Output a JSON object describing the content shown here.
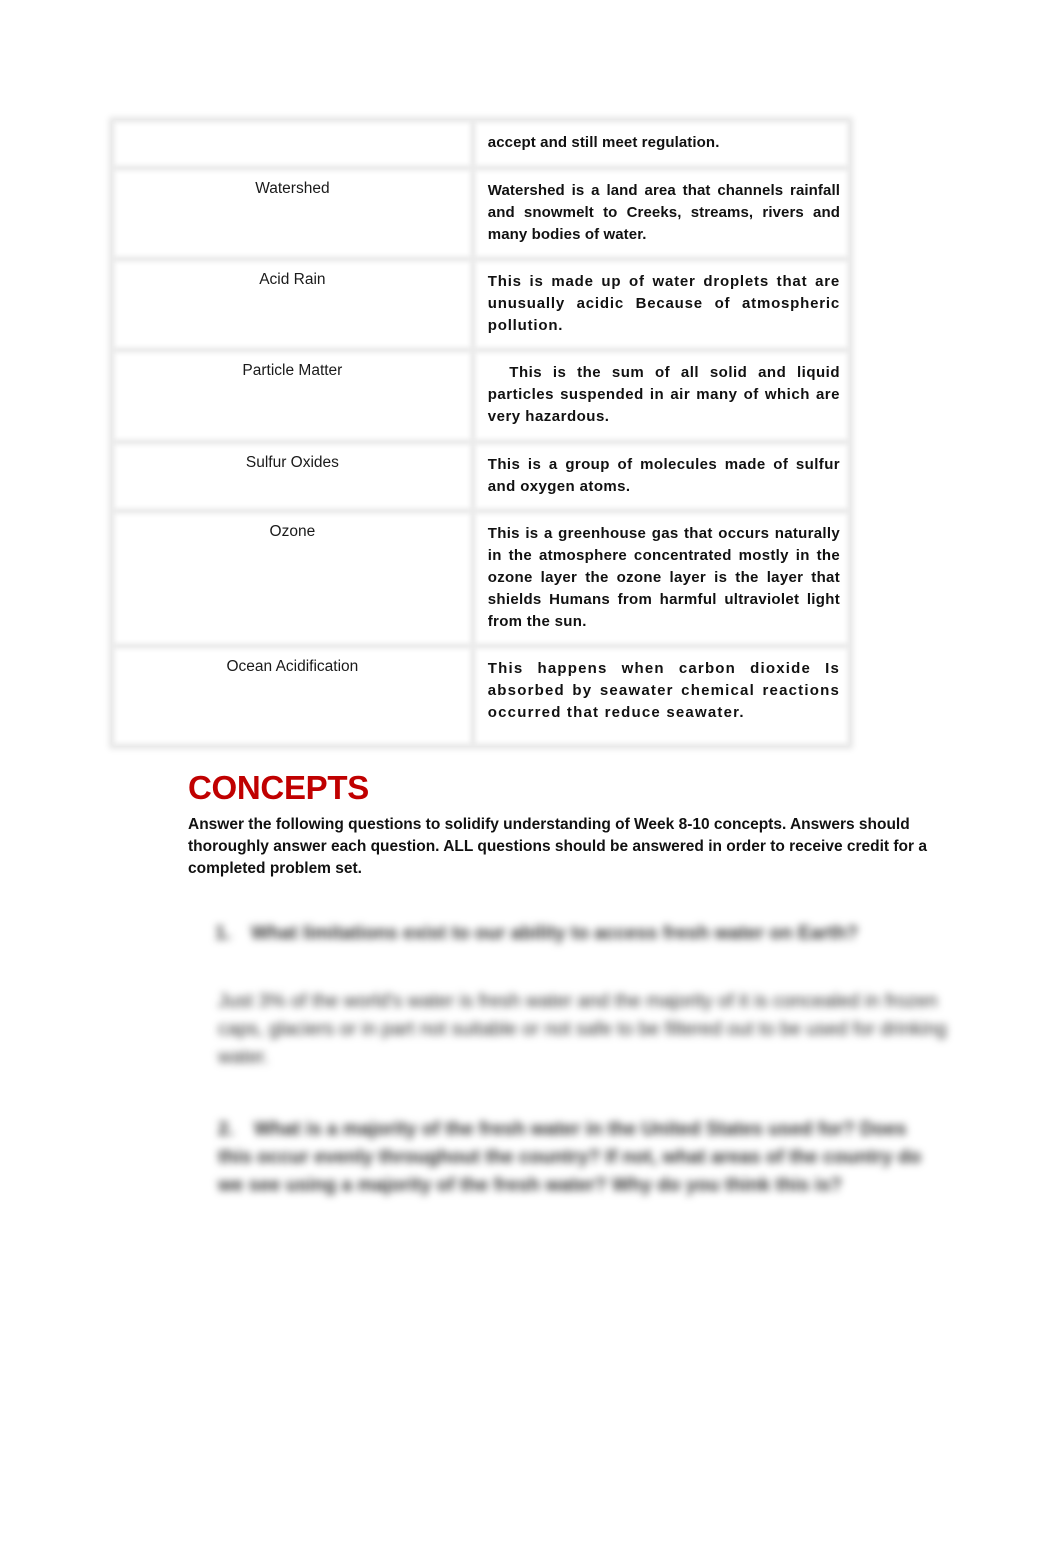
{
  "glossary": {
    "rows": [
      {
        "term": "",
        "definition": "accept and still meet regulation."
      },
      {
        "term": "Watershed",
        "definition": "Watershed is a land area that channels rainfall and snowmelt to Creeks, streams, rivers and many bodies of water."
      },
      {
        "term": "Acid Rain",
        "definition": "This is made up of water droplets that are unusually acidic Because of atmospheric pollution."
      },
      {
        "term": "Particle Matter",
        "definition": "  This is the sum of all solid and liquid particles suspended in air many of which are very hazardous."
      },
      {
        "term": "Sulfur Oxides",
        "definition": "This is a group of molecules made of sulfur and oxygen atoms."
      },
      {
        "term": "Ozone",
        "definition": "This is a greenhouse gas that occurs naturally in the atmosphere concentrated mostly in the ozone layer the ozone layer is the layer that shields Humans from harmful ultraviolet light from the sun."
      },
      {
        "term": "Ocean Acidification",
        "definition": "This happens when carbon dioxide Is absorbed by seawater chemical reactions occurred that reduce seawater."
      }
    ]
  },
  "concepts": {
    "heading": "CONCEPTS",
    "heading_color": "#c00000",
    "intro": "Answer the following questions to solidify understanding of Week 8-10 concepts. Answers should thoroughly answer each question. ALL questions should be answered in order to receive credit for a completed problem set.",
    "blurred": {
      "q1_number": "1.",
      "q1_text": "What limitations exist to our ability to access fresh water on Earth?",
      "a1_text": "Just 3% of the world's water is fresh water and the majority of it is concealed in frozen caps, glaciers or in part not suitable or not safe to be filtered out to be used for drinking water.",
      "q2_number": "2.",
      "q2_text": "What is a majority of the fresh water in the United States used for? Does this occur evenly throughout the country? If not, what areas of the country do we see using a majority of the fresh water? Why do you think this is?"
    }
  }
}
